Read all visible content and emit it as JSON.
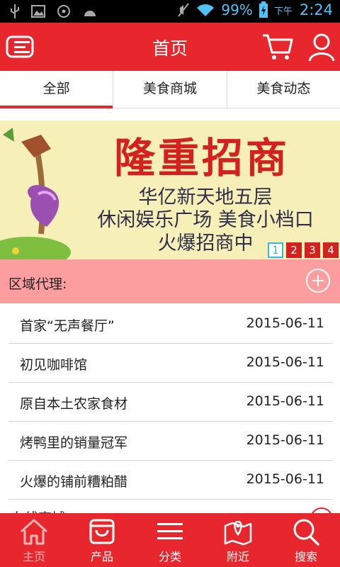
{
  "status_bar": {
    "battery": "99%",
    "ampm": "下午",
    "time": "2:24"
  },
  "header": {
    "title": "首页"
  },
  "tabs": [
    {
      "label": "全部",
      "active": true
    },
    {
      "label": "美食商城",
      "active": false
    },
    {
      "label": "美食动态",
      "active": false
    }
  ],
  "banner": {
    "headline": "隆重招商",
    "line1": "华亿新天地五层",
    "line2": "休闲娱乐广场 美食小档口",
    "line3": "火爆招商中",
    "pages": [
      "1",
      "2",
      "3",
      "4"
    ],
    "active_page": "1"
  },
  "section": {
    "label": "区域代理:",
    "items": [
      {
        "name": "首家“无声餐厅”",
        "date": "2015-06-11"
      },
      {
        "name": "初见咖啡馆",
        "date": "2015-06-11"
      },
      {
        "name": "原自本土农家食材",
        "date": "2015-06-11"
      },
      {
        "name": "烤鸭里的销量冠军",
        "date": "2015-06-11"
      },
      {
        "name": "火爆的铺前糟粕醋",
        "date": "2015-06-11"
      }
    ]
  },
  "next_section": {
    "label": "在线商城"
  },
  "bottom_nav": [
    {
      "label": "主页",
      "icon": "home-icon",
      "active": true
    },
    {
      "label": "产品",
      "icon": "bag-icon",
      "active": false
    },
    {
      "label": "分类",
      "icon": "list-icon",
      "active": false
    },
    {
      "label": "附近",
      "icon": "map-icon",
      "active": false
    },
    {
      "label": "搜索",
      "icon": "search-icon",
      "active": false
    }
  ],
  "colors": {
    "primary": "#e8262d",
    "section_bg": "#fc9e9f",
    "active_nav": "#f5b5b5",
    "banner_bg": "#f7efb8"
  }
}
